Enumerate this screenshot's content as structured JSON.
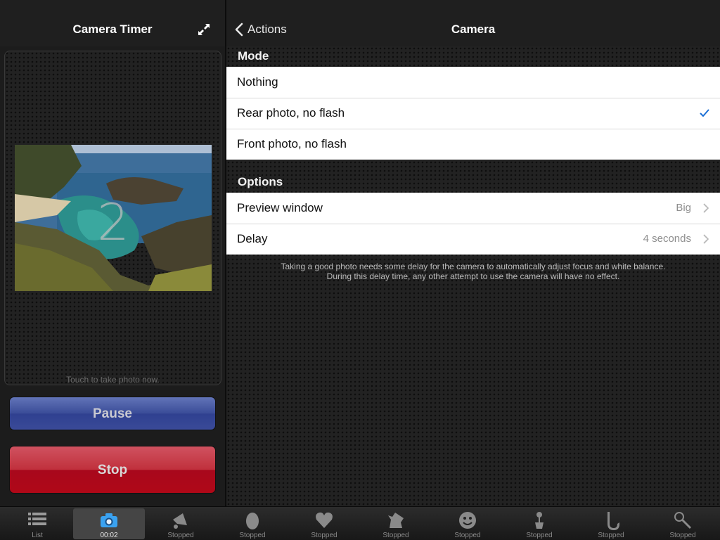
{
  "left_panel": {
    "title": "Camera Timer",
    "countdown": "2",
    "touch_hint": "Touch to take photo now.",
    "pause_label": "Pause",
    "stop_label": "Stop"
  },
  "right_panel": {
    "back_label": "Actions",
    "title": "Camera",
    "mode_header": "Mode",
    "mode_options": [
      {
        "label": "Nothing",
        "selected": false
      },
      {
        "label": "Rear photo, no flash",
        "selected": true
      },
      {
        "label": "Front photo, no flash",
        "selected": false
      }
    ],
    "options_header": "Options",
    "options": [
      {
        "label": "Preview window",
        "value": "Big"
      },
      {
        "label": "Delay",
        "value": "4 seconds"
      }
    ],
    "footer_line1": "Taking a good photo needs some delay for the camera to automatically adjust focus and white balance.",
    "footer_line2": "During this delay time, any other attempt to use the camera will have no effect."
  },
  "tabbar": {
    "tabs": [
      {
        "icon": "list-icon",
        "label": "List"
      },
      {
        "icon": "camera-icon",
        "label": "00:02",
        "active": true
      },
      {
        "icon": "megaphone-icon",
        "label": "Stopped"
      },
      {
        "icon": "egg-icon",
        "label": "Stopped"
      },
      {
        "icon": "heart-icon",
        "label": "Stopped"
      },
      {
        "icon": "dog-icon",
        "label": "Stopped"
      },
      {
        "icon": "smiley-icon",
        "label": "Stopped"
      },
      {
        "icon": "flower-pot-icon",
        "label": "Stopped"
      },
      {
        "icon": "saxophone-icon",
        "label": "Stopped"
      },
      {
        "icon": "badminton-icon",
        "label": "Stopped"
      }
    ]
  },
  "colors": {
    "accent_check": "#1a6fd6",
    "pause_button": "#3a4c98",
    "stop_button": "#b00818"
  }
}
